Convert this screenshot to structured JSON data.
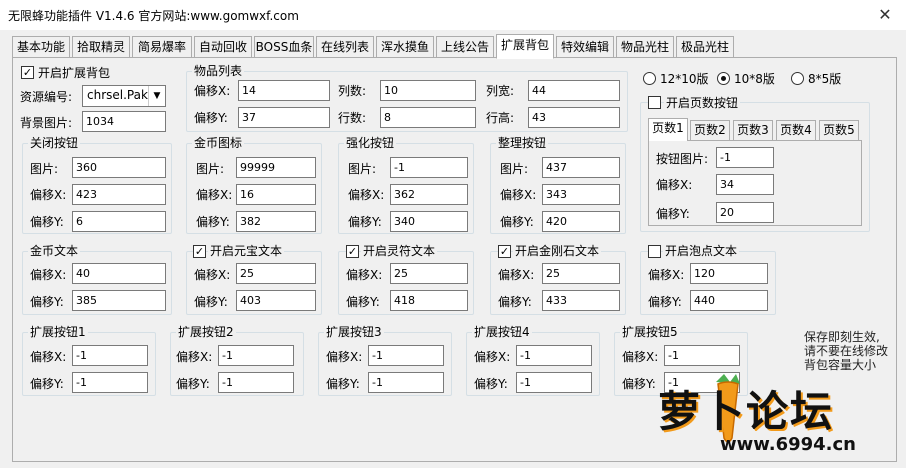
{
  "window": {
    "title": "无限蜂功能插件 V1.4.6  官方网站:www.gomwxf.com",
    "close": "✕"
  },
  "tabs": [
    "基本功能",
    "拾取精灵",
    "简易爆率",
    "自动回收",
    "BOSS血条",
    "在线列表",
    "浑水摸鱼",
    "上线公告",
    "扩展背包",
    "特效编辑",
    "物品光柱",
    "极品光柱"
  ],
  "top": {
    "enable_label": "开启扩展背包",
    "resource_label": "资源编号:",
    "resource_value": "chrsel.Pak",
    "bg_label": "背景图片:",
    "bg_value": "1034"
  },
  "item_list": {
    "title": "物品列表",
    "offx_label": "偏移X:",
    "offx": "14",
    "offy_label": "偏移Y:",
    "offy": "37",
    "cols_label": "列数:",
    "cols": "10",
    "rows_label": "行数:",
    "rows": "8",
    "colw_label": "列宽:",
    "colw": "44",
    "rowh_label": "行高:",
    "rowh": "43"
  },
  "layout": {
    "opt1": "12*10版",
    "opt2": "10*8版",
    "opt3": "8*5版"
  },
  "pager": {
    "enable_label": "开启页数按钮",
    "pages": [
      "页数1",
      "页数2",
      "页数3",
      "页数4",
      "页数5"
    ],
    "img_label": "按钮图片:",
    "img": "-1",
    "offx_label": "偏移X:",
    "offx": "34",
    "offy_label": "偏移Y:",
    "offy": "20"
  },
  "btn_groups": [
    {
      "title": "关闭按钮",
      "l1": "图片:",
      "v1": "360",
      "l2": "偏移X:",
      "v2": "423",
      "l3": "偏移Y:",
      "v3": "6"
    },
    {
      "title": "金币图标",
      "l1": "图片:",
      "v1": "99999",
      "l2": "偏移X:",
      "v2": "16",
      "l3": "偏移Y:",
      "v3": "382"
    },
    {
      "title": "强化按钮",
      "l1": "图片:",
      "v1": "-1",
      "l2": "偏移X:",
      "v2": "362",
      "l3": "偏移Y:",
      "v3": "340"
    },
    {
      "title": "整理按钮",
      "l1": "图片:",
      "v1": "437",
      "l2": "偏移X:",
      "v2": "343",
      "l3": "偏移Y:",
      "v3": "420"
    }
  ],
  "text_groups": [
    {
      "title": "金币文本",
      "l1": "偏移X:",
      "v1": "40",
      "l2": "偏移Y:",
      "v2": "385"
    },
    {
      "title": "开启元宝文本",
      "l1": "偏移X:",
      "v1": "25",
      "l2": "偏移Y:",
      "v2": "403"
    },
    {
      "title": "开启灵符文本",
      "l1": "偏移X:",
      "v1": "25",
      "l2": "偏移Y:",
      "v2": "418"
    },
    {
      "title": "开启金刚石文本",
      "l1": "偏移X:",
      "v1": "25",
      "l2": "偏移Y:",
      "v2": "433"
    },
    {
      "title": "开启泡点文本",
      "l1": "偏移X:",
      "v1": "120",
      "l2": "偏移Y:",
      "v2": "440"
    }
  ],
  "ext_groups": [
    {
      "title": "扩展按钮1",
      "l1": "偏移X:",
      "v1": "-1",
      "l2": "偏移Y:",
      "v2": "-1"
    },
    {
      "title": "扩展按钮2",
      "l1": "偏移X:",
      "v1": "-1",
      "l2": "偏移Y:",
      "v2": "-1"
    },
    {
      "title": "扩展按钮3",
      "l1": "偏移X:",
      "v1": "-1",
      "l2": "偏移Y:",
      "v2": "-1"
    },
    {
      "title": "扩展按钮4",
      "l1": "偏移X:",
      "v1": "-1",
      "l2": "偏移Y:",
      "v2": "-1"
    },
    {
      "title": "扩展按钮5",
      "l1": "偏移X:",
      "v1": "-1",
      "l2": "偏移Y:",
      "v2": "-1"
    }
  ],
  "note": {
    "l1": "保存即刻生效,",
    "l2": "请不要在线修改",
    "l3": "背包容量大小"
  },
  "watermark": {
    "name": "萝卜论坛",
    "url": "www.6994.cn"
  },
  "colors": {
    "accent": "#0078d7",
    "watermark_orange": "#f29a1a"
  }
}
